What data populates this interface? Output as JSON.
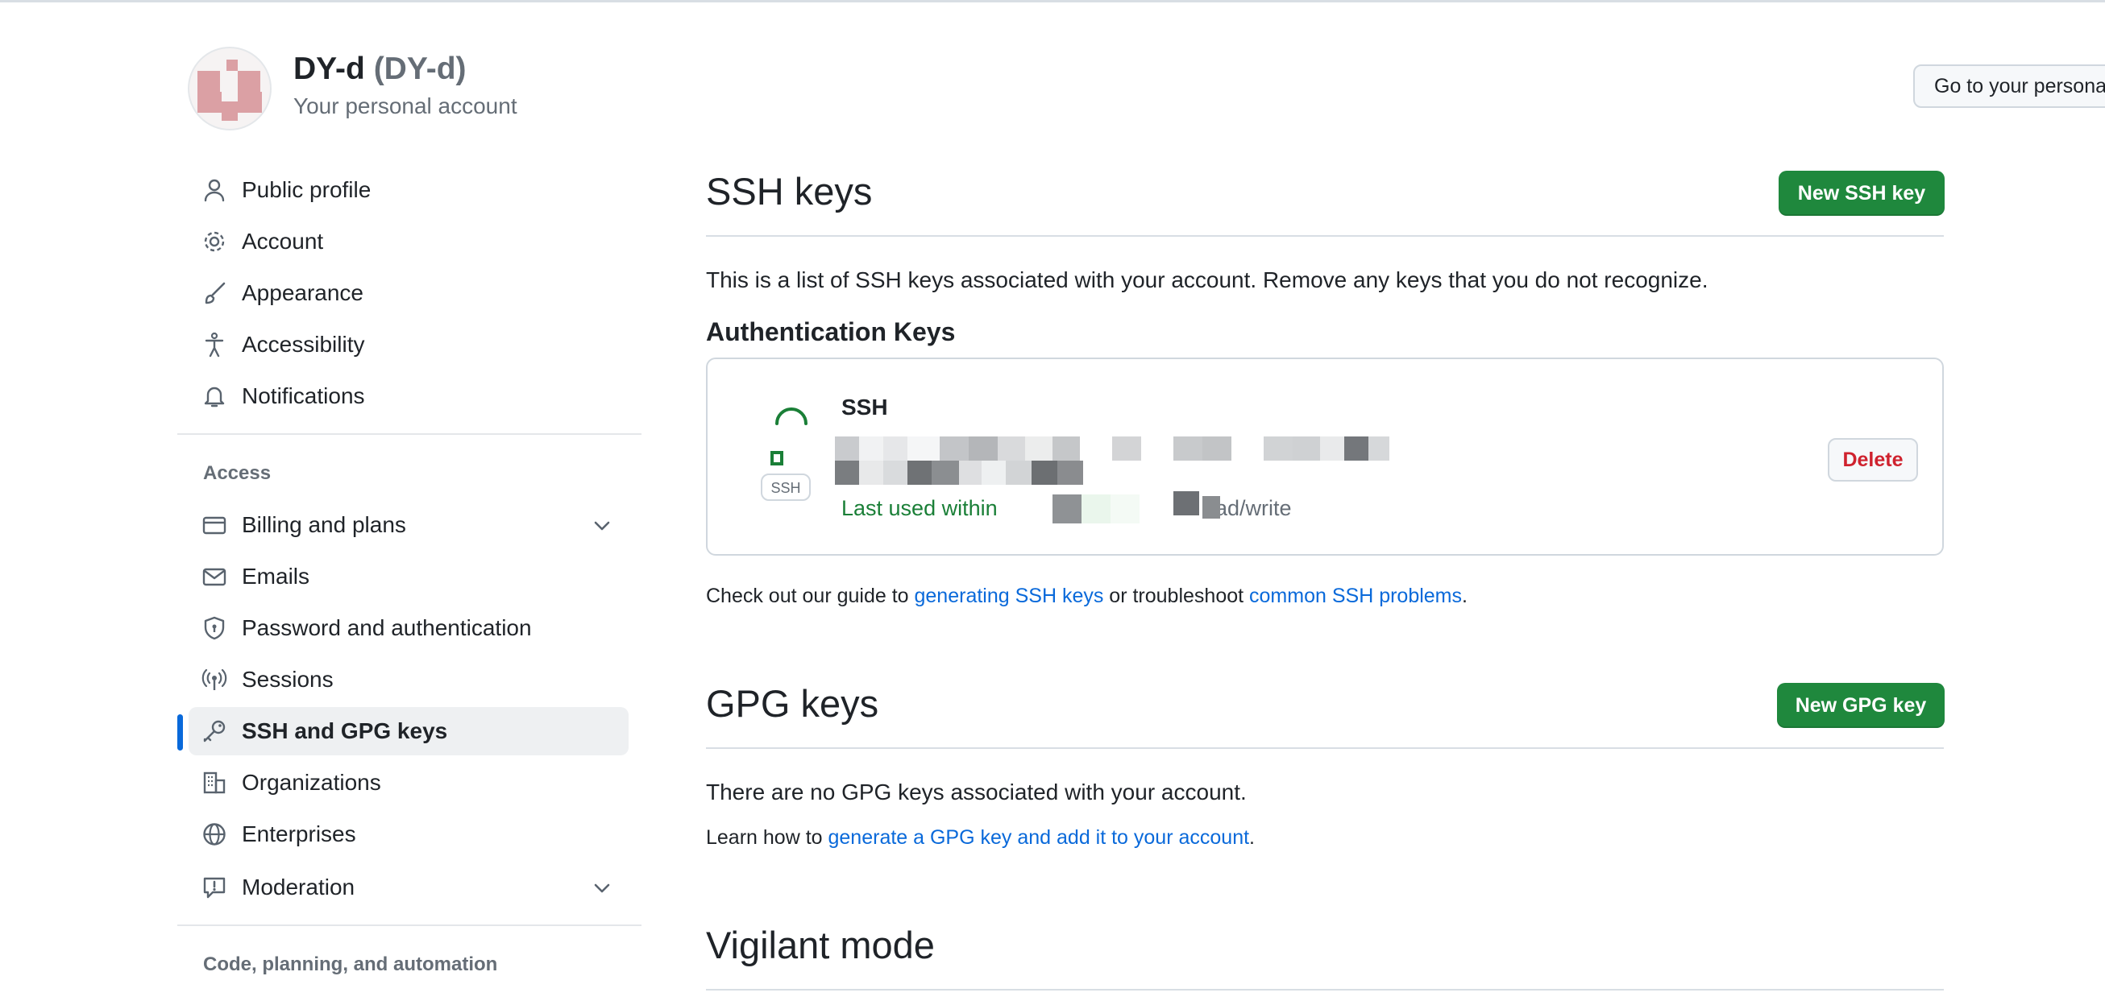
{
  "header": {
    "display_name": "DY-d",
    "login": "(DY-d)",
    "subtitle": "Your personal account",
    "goto_button": "Go to your personal profile"
  },
  "sidebar": {
    "items": [
      {
        "label": "Public profile",
        "icon": "person-icon"
      },
      {
        "label": "Account",
        "icon": "gear-icon"
      },
      {
        "label": "Appearance",
        "icon": "paintbrush-icon"
      },
      {
        "label": "Accessibility",
        "icon": "accessibility-icon"
      },
      {
        "label": "Notifications",
        "icon": "bell-icon"
      }
    ],
    "access_group": "Access",
    "access_items": [
      {
        "label": "Billing and plans",
        "icon": "credit-card-icon",
        "expandable": true
      },
      {
        "label": "Emails",
        "icon": "mail-icon"
      },
      {
        "label": "Password and authentication",
        "icon": "shield-lock-icon"
      },
      {
        "label": "Sessions",
        "icon": "broadcast-icon"
      },
      {
        "label": "SSH and GPG keys",
        "icon": "key-icon",
        "active": true
      },
      {
        "label": "Organizations",
        "icon": "organization-icon"
      },
      {
        "label": "Enterprises",
        "icon": "globe-icon"
      },
      {
        "label": "Moderation",
        "icon": "report-icon",
        "expandable": true
      }
    ],
    "code_group": "Code, planning, and automation"
  },
  "ssh": {
    "title": "SSH keys",
    "new_button": "New SSH key",
    "description": "This is a list of SSH keys associated with your account. Remove any keys that you do not recognize.",
    "auth_heading": "Authentication Keys",
    "key": {
      "title": "SSH",
      "badge": "SSH",
      "last_used": "Last used within",
      "permission": "ad/write",
      "delete_label": "Delete"
    },
    "help_prefix": "Check out our guide to ",
    "help_link1": "generating SSH keys",
    "help_mid": " or troubleshoot ",
    "help_link2": "common SSH problems",
    "help_suffix": "."
  },
  "gpg": {
    "title": "GPG keys",
    "new_button": "New GPG key",
    "empty": "There are no GPG keys associated with your account.",
    "learn_prefix": "Learn how to ",
    "learn_link": "generate a GPG key and add it to your account",
    "learn_suffix": "."
  },
  "vigilant": {
    "title": "Vigilant mode"
  },
  "colors": {
    "accent": "#0969da",
    "primary_button": "#1f883d",
    "danger": "#cf222e",
    "success_text": "#1a7f37"
  }
}
